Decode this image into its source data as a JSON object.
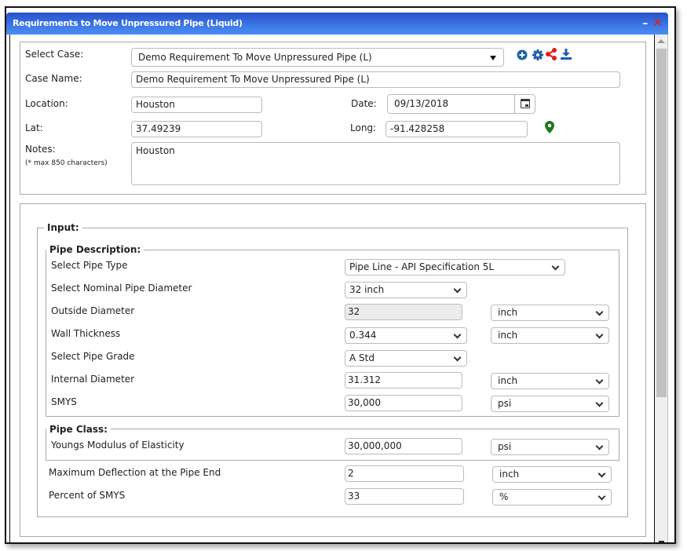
{
  "window": {
    "title": "Requirements to Move Unpressured Pipe (Liquid)",
    "minimize_label": "–",
    "close_label": "×"
  },
  "case": {
    "select_case_label": "Select Case:",
    "select_case_value": "Demo Requirement To Move Unpressured Pipe (L)",
    "case_name_label": "Case Name:",
    "case_name_value": "Demo Requirement To Move Unpressured Pipe (L)",
    "location_label": "Location:",
    "location_value": "Houston",
    "date_label": "Date:",
    "date_value": "09/13/2018",
    "lat_label": "Lat:",
    "lat_value": "37.49239",
    "long_label": "Long:",
    "long_value": "-91.428258",
    "notes_label": "Notes:",
    "notes_hint": "(* max 850 characters)",
    "notes_value": "Houston",
    "toolbar_icons": [
      "plus-circle-icon",
      "gear-icon",
      "share-icon",
      "download-icon"
    ]
  },
  "colors": {
    "title_bar": "#3c78e6",
    "icon_blue": "#1f5fa8",
    "share_red": "#e41b1b",
    "map_pin_green": "#1b7a1b"
  },
  "input": {
    "legend": "Input:",
    "pipe_description": {
      "legend": "Pipe Description:",
      "pipe_type_label": "Select Pipe Type",
      "pipe_type_value": "Pipe Line - API Specification 5L",
      "nominal_diameter_label": "Select Nominal Pipe Diameter",
      "nominal_diameter_value": "32 inch",
      "outside_diameter_label": "Outside Diameter",
      "outside_diameter_value": "32",
      "outside_diameter_unit": "inch",
      "wall_thickness_label": "Wall Thickness",
      "wall_thickness_value": "0.344",
      "wall_thickness_unit": "inch",
      "pipe_grade_label": "Select Pipe Grade",
      "pipe_grade_value": "A Std",
      "internal_diameter_label": "Internal Diameter",
      "internal_diameter_value": "31.312",
      "internal_diameter_unit": "inch",
      "smys_label": "SMYS",
      "smys_value": "30,000",
      "smys_unit": "psi"
    },
    "pipe_class": {
      "legend": "Pipe Class:",
      "youngs_label": "Youngs Modulus of Elasticity",
      "youngs_value": "30,000,000",
      "youngs_unit": "psi"
    },
    "max_deflection_label": "Maximum Deflection at the Pipe End",
    "max_deflection_value": "2",
    "max_deflection_unit": "inch",
    "percent_smys_label": "Percent of SMYS",
    "percent_smys_value": "33",
    "percent_smys_unit": "%"
  }
}
